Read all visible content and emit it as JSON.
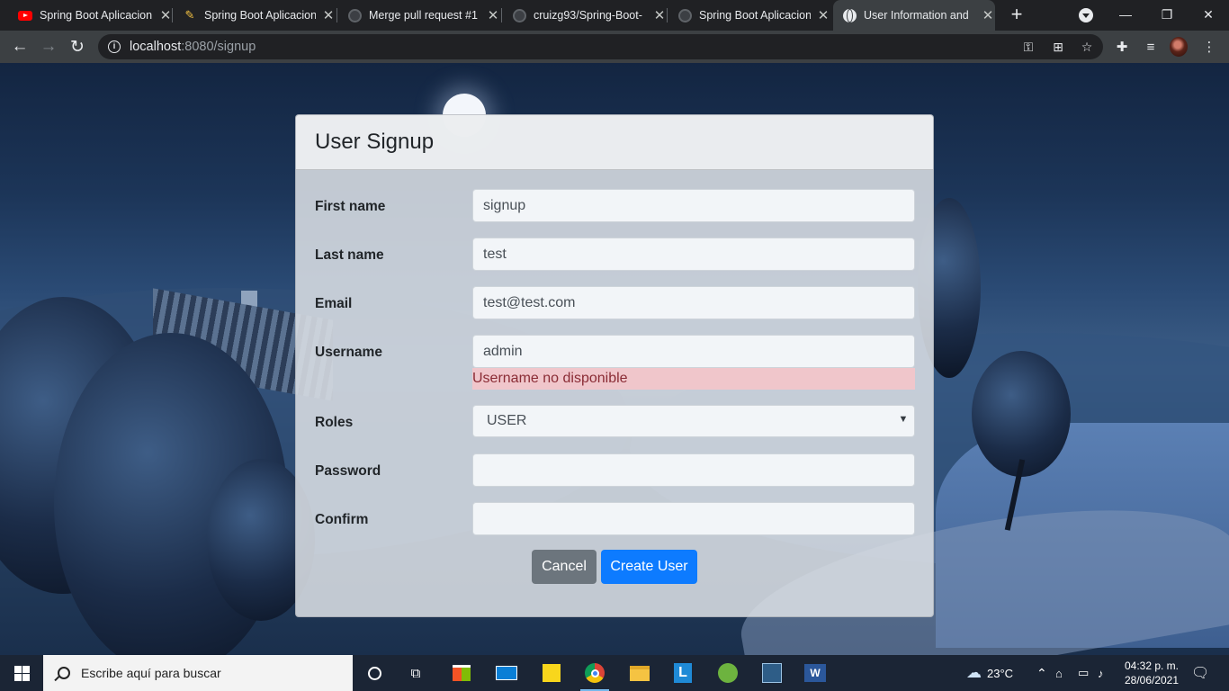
{
  "browser": {
    "tabs": [
      {
        "title": "Spring Boot Aplicacion",
        "icon": "youtube-icon"
      },
      {
        "title": "Spring Boot Aplicacion",
        "icon": "pencil-logo-icon"
      },
      {
        "title": "Merge pull request #1",
        "icon": "github-icon"
      },
      {
        "title": "cruizg93/Spring-Boot-",
        "icon": "github-icon"
      },
      {
        "title": "Spring Boot Aplicacion",
        "icon": "github-icon"
      },
      {
        "title": "User Information and",
        "icon": "globe-icon",
        "active": true
      }
    ],
    "url_host": "localhost",
    "url_rest": ":8080/signup"
  },
  "form": {
    "title": "User Signup",
    "fields": {
      "first_name": {
        "label": "First name",
        "value": "signup"
      },
      "last_name": {
        "label": "Last name",
        "value": "test"
      },
      "email": {
        "label": "Email",
        "value": "test@test.com"
      },
      "username": {
        "label": "Username",
        "value": "admin",
        "error": "Username no disponible"
      },
      "roles": {
        "label": "Roles",
        "value": "USER"
      },
      "password": {
        "label": "Password",
        "value": ""
      },
      "confirm": {
        "label": "Confirm",
        "value": ""
      }
    },
    "cancel_label": "Cancel",
    "submit_label": "Create User",
    "colors": {
      "primary": "#007bff",
      "secondary": "#6c757d",
      "error_bg": "#f8d7da"
    }
  },
  "taskbar": {
    "search_placeholder": "Escribe aquí para buscar",
    "weather": "23°C",
    "time": "04:32 p. m.",
    "date": "28/06/2021"
  }
}
